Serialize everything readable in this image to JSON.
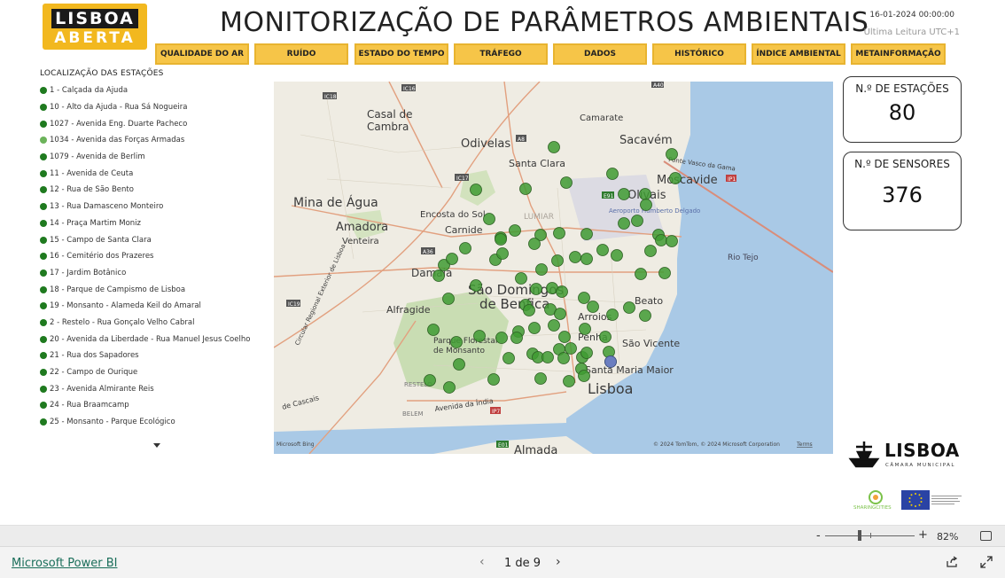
{
  "header": {
    "logo_line1": "LISBOA",
    "logo_line2": "ABERTA",
    "title": "MONITORIZAÇÃO DE PARÂMETROS AMBIENTAIS",
    "datetime": "16-01-2024 00:00:00",
    "last_reading": "Última Leitura UTC+1"
  },
  "nav": [
    {
      "label": "QUALIDADE DO AR"
    },
    {
      "label": "RUÍDO"
    },
    {
      "label": "ESTADO DO TEMPO"
    },
    {
      "label": "TRÁFEGO"
    },
    {
      "label": "DADOS"
    },
    {
      "label": "HISTÓRICO"
    },
    {
      "label": "ÍNDICE AMBIENTAL"
    },
    {
      "label": "METAINFORMAÇÃO"
    }
  ],
  "stations": {
    "title": "LOCALIZAÇÃO DAS ESTAÇÕES",
    "items": [
      {
        "label": "1 - Calçada da Ajuda",
        "color": "#1f7a1f"
      },
      {
        "label": "10 - Alto da Ajuda - Rua Sá Nogueira",
        "color": "#1f7a1f"
      },
      {
        "label": "1027 - Avenida Eng. Duarte Pacheco",
        "color": "#1f7a1f"
      },
      {
        "label": "1034 - Avenida das Forças Armadas",
        "color": "#6cb35a"
      },
      {
        "label": "1079 - Avenida de Berlim",
        "color": "#1f7a1f"
      },
      {
        "label": "11 - Avenida de Ceuta",
        "color": "#1f7a1f"
      },
      {
        "label": "12 - Rua de São Bento",
        "color": "#1f7a1f"
      },
      {
        "label": "13 - Rua Damasceno Monteiro",
        "color": "#1f7a1f"
      },
      {
        "label": "14 - Praça Martim Moniz",
        "color": "#1f7a1f"
      },
      {
        "label": "15 - Campo de Santa Clara",
        "color": "#1f7a1f"
      },
      {
        "label": "16 - Cemitério dos Prazeres",
        "color": "#1f7a1f"
      },
      {
        "label": "17 - Jardim Botânico",
        "color": "#1f7a1f"
      },
      {
        "label": "18 - Parque de Campismo de Lisboa",
        "color": "#1f7a1f"
      },
      {
        "label": "19 - Monsanto - Alameda Keil do Amaral",
        "color": "#1f7a1f"
      },
      {
        "label": "2 - Restelo - Rua Gonçalo Velho Cabral",
        "color": "#1f7a1f"
      },
      {
        "label": "20 - Avenida da Liberdade - Rua Manuel Jesus Coelho",
        "color": "#1f7a1f"
      },
      {
        "label": "21 - Rua dos Sapadores",
        "color": "#1f7a1f"
      },
      {
        "label": "22 - Campo de Ourique",
        "color": "#1f7a1f"
      },
      {
        "label": "23 - Avenida Almirante Reis",
        "color": "#1f7a1f"
      },
      {
        "label": "24 - Rua Braamcamp",
        "color": "#1f7a1f"
      },
      {
        "label": "25 - Monsanto - Parque Ecológico",
        "color": "#1f7a1f"
      }
    ]
  },
  "map": {
    "labels": {
      "casal": "Casal de",
      "cambra": "Cambra",
      "odivelas": "Odivelas",
      "camarate": "Camarate",
      "sacavem": "Sacavém",
      "santa_clara": "Santa Clara",
      "ponte": "Ponte Vasco da Gama",
      "mina": "Mina de Água",
      "encosta": "Encosta do Sol",
      "lumiar": "LUMIAR",
      "olivais": "Olivais",
      "moscavide": "Moscavide",
      "aeroporto": "Aeroporto Humberto Delgado",
      "amadora": "Amadora",
      "venteira": "Venteira",
      "carnide": "Carnide",
      "damaia": "Damaia",
      "rio_tejo": "Rio Tejo",
      "sao_domingos": "São Domingos",
      "de_benfica": "de Benfica",
      "alfragide": "Alfragide",
      "arroios": "Arroios",
      "beato": "Beato",
      "parque": "Parque Florestal",
      "de_monsanto": "de Monsanto",
      "penha": "Penha",
      "sao_vicente": "São Vicente",
      "santa_maria": "Santa Maria Maior",
      "restelo": "RESTELO",
      "lisboa": "Lisboa",
      "belem": "BELEM",
      "av_india": "Avenida da Índia",
      "almada": "Almada",
      "cascais": "de Cascais",
      "circular": "Circular Regional Exterior de Lisboa"
    },
    "road_shields": [
      "IC18",
      "IC16",
      "A8",
      "IC17",
      "A36",
      "E91",
      "IP1",
      "A40",
      "IC19",
      "IP7",
      "E01"
    ],
    "attribution": "© 2024 TomTom, © 2024 Microsoft Corporation",
    "terms": "Terms",
    "bing": "Microsoft Bing",
    "marker_color": "#3f9b32",
    "marker_highlight": "#6b7ec0"
  },
  "kpis": {
    "stations_label": "N.º DE ESTAÇÕES",
    "stations_value": "80",
    "sensors_label": "N.º DE SENSORES",
    "sensors_value": "376"
  },
  "branding": {
    "lisboa": "LISBOA",
    "camara": "CÂMARA MUNICIPAL",
    "sharing": "SHARINGCITIES"
  },
  "zoom": {
    "minus": "-",
    "plus": "+",
    "percent": "82%"
  },
  "footer": {
    "powerbi": "Microsoft Power BI",
    "page": "1 de 9",
    "prev": "‹",
    "next": "›"
  }
}
